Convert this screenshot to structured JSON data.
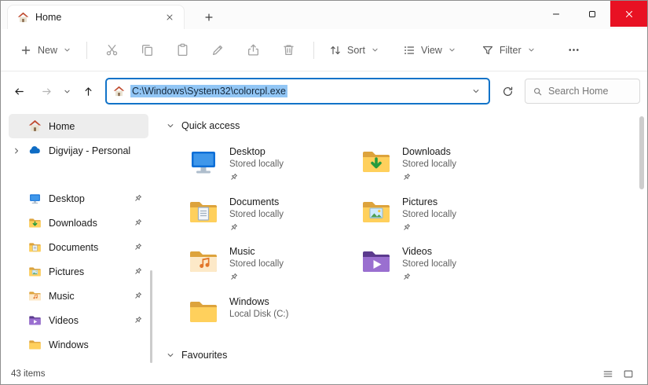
{
  "window": {
    "tab_title": "Home"
  },
  "toolbar": {
    "new_label": "New",
    "sort_label": "Sort",
    "view_label": "View",
    "filter_label": "Filter"
  },
  "address": {
    "path": "C:\\Windows\\System32\\colorcpl.exe",
    "search_placeholder": "Search Home"
  },
  "sidebar": {
    "items": [
      {
        "label": "Home"
      },
      {
        "label": "Digvijay - Personal"
      },
      {
        "label": "Desktop"
      },
      {
        "label": "Downloads"
      },
      {
        "label": "Documents"
      },
      {
        "label": "Pictures"
      },
      {
        "label": "Music"
      },
      {
        "label": "Videos"
      },
      {
        "label": "Windows"
      }
    ]
  },
  "content": {
    "quick_access_label": "Quick access",
    "favourites_label": "Favourites",
    "tiles": [
      {
        "name": "Desktop",
        "subtitle": "Stored locally"
      },
      {
        "name": "Downloads",
        "subtitle": "Stored locally"
      },
      {
        "name": "Documents",
        "subtitle": "Stored locally"
      },
      {
        "name": "Pictures",
        "subtitle": "Stored locally"
      },
      {
        "name": "Music",
        "subtitle": "Stored locally"
      },
      {
        "name": "Videos",
        "subtitle": "Stored locally"
      },
      {
        "name": "Windows",
        "subtitle": "Local Disk (C:)"
      }
    ]
  },
  "statusbar": {
    "items_count": "43 items"
  },
  "colors": {
    "accent_focus": "#1273c8",
    "selection_bg": "#92c6f5",
    "close_button": "#e81123",
    "folder_yellow": "#ffd05c"
  },
  "icons": [
    "home-icon",
    "onedrive-icon",
    "desktop-icon",
    "downloads-icon",
    "documents-icon",
    "pictures-icon",
    "music-icon",
    "videos-icon",
    "folder-icon",
    "pin-icon",
    "cut-icon",
    "copy-icon",
    "paste-icon",
    "rename-icon",
    "share-icon",
    "delete-icon",
    "sort-icon",
    "view-icon",
    "filter-icon",
    "more-icon",
    "back-icon",
    "forward-icon",
    "up-icon",
    "refresh-icon",
    "search-icon",
    "plus-icon",
    "chevron-down-icon",
    "chevron-right-icon",
    "close-icon",
    "minimize-icon",
    "maximize-icon",
    "list-view-icon",
    "thumbnail-view-icon"
  ]
}
